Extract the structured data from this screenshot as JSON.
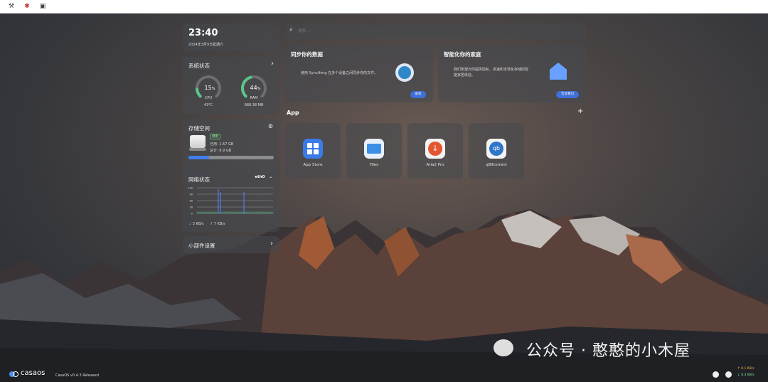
{
  "topbar": {
    "icons": [
      "tool-icon-1",
      "tool-icon-2",
      "tool-icon-3"
    ]
  },
  "clock": {
    "time": "23:40",
    "date": "2024年3月9日星期六"
  },
  "system_status": {
    "title": "系统状态",
    "cpu": {
      "percent": 15,
      "label": "CPU",
      "extra": "43°C"
    },
    "ram": {
      "percent": 44,
      "label": "RAM",
      "extra": "988.38 MB"
    }
  },
  "storage": {
    "title": "存储空间",
    "badge": "健康",
    "used": "已用: 1.67 GB",
    "total": "总计: 6.9 GB",
    "fraction": 0.24
  },
  "network": {
    "title": "网络状态",
    "interface": "eth0",
    "y_ticks": [
      "120",
      "90",
      "60",
      "30",
      "0"
    ],
    "down": "3 KB/s",
    "up": "7 KB/s"
  },
  "widget_settings": {
    "title": "小部件设置"
  },
  "search": {
    "placeholder": "搜索..."
  },
  "sync_card": {
    "title": "同步你的数据",
    "desc": "使用 Syncthing 在多个设备之间同步你的文件。",
    "button": "安装"
  },
  "smart_card": {
    "title": "智能化你的家庭",
    "desc1": "我们希望为你提供隐私、高速和本地化存储的智",
    "desc2": "能家居体验。",
    "button": "告诉我们"
  },
  "apps": {
    "title": "App",
    "add": "+",
    "items": [
      {
        "name": "App Store"
      },
      {
        "name": "Files"
      },
      {
        "name": "Aria2 Pro"
      },
      {
        "name": "qBittorrent"
      }
    ]
  },
  "taskbar": {
    "logo": "casaos",
    "version": "CasaOS v0.4.3 Released",
    "speed_down": "0.1 KB/s",
    "speed_up": "0.3 KB/s"
  },
  "watermark": {
    "text": "公众号 · 憨憨的小木屋"
  }
}
